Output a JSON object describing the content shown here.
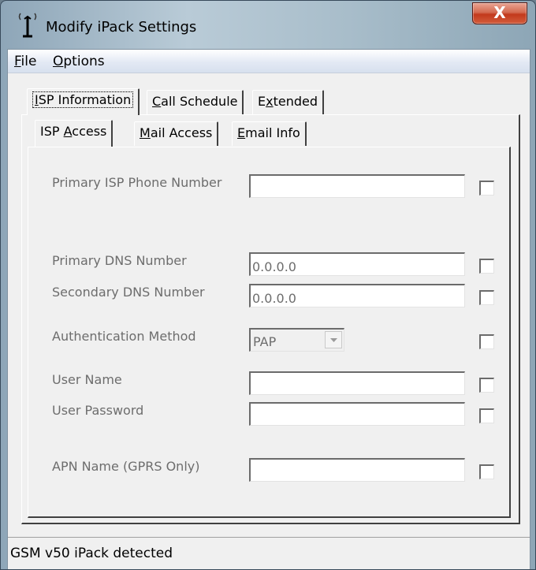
{
  "window": {
    "title": "Modify iPack Settings",
    "close_glyph": "X"
  },
  "menu": {
    "file": {
      "accel": "F",
      "rest": "ile"
    },
    "options": {
      "accel": "O",
      "rest": "ptions"
    }
  },
  "tabs": [
    {
      "pre": "",
      "accel": "I",
      "post": "SP Information",
      "active": true
    },
    {
      "pre": "",
      "accel": "C",
      "post": "all Schedule",
      "active": false
    },
    {
      "pre": "E",
      "accel": "x",
      "post": "tended",
      "active": false
    }
  ],
  "subtabs": [
    {
      "pre": "ISP ",
      "accel": "A",
      "post": "ccess",
      "active": true
    },
    {
      "pre": "",
      "accel": "M",
      "post": "ail Access",
      "active": false
    },
    {
      "pre": "",
      "accel": "E",
      "post": "mail Info",
      "active": false
    }
  ],
  "form": {
    "primary_isp_phone": {
      "label": "Primary ISP Phone Number",
      "value": "",
      "checked": false
    },
    "primary_dns": {
      "label": "Primary DNS Number",
      "value": "0.0.0.0",
      "checked": false
    },
    "secondary_dns": {
      "label": "Secondary DNS Number",
      "value": "0.0.0.0",
      "checked": false
    },
    "auth_method": {
      "label": "Authentication Method",
      "value": "PAP",
      "checked": false
    },
    "user_name": {
      "label": "User Name",
      "value": "",
      "checked": false
    },
    "user_password": {
      "label": "User Password",
      "value": "",
      "checked": false
    },
    "apn_name": {
      "label": "APN Name (GPRS Only)",
      "value": "",
      "checked": false
    }
  },
  "status": {
    "text": "GSM v50 iPack detected"
  },
  "colors": {
    "close_button": "#c2391c",
    "disabled_text": "#6d6d6d",
    "dialog_face": "#f0f0f0"
  },
  "icons": {
    "title": "antenna-icon",
    "close": "close-icon",
    "combo_arrow": "chevron-down-icon"
  }
}
